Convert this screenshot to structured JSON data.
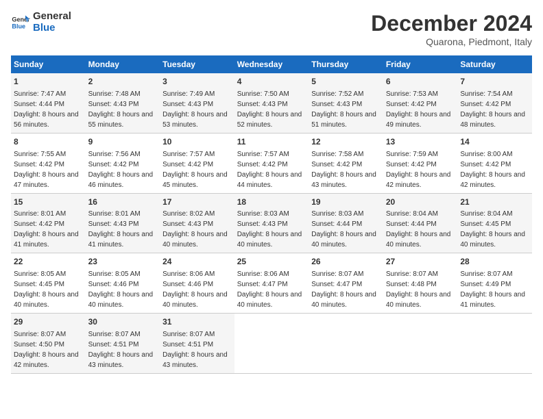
{
  "header": {
    "logo_line1": "General",
    "logo_line2": "Blue",
    "month": "December 2024",
    "location": "Quarona, Piedmont, Italy"
  },
  "days_of_week": [
    "Sunday",
    "Monday",
    "Tuesday",
    "Wednesday",
    "Thursday",
    "Friday",
    "Saturday"
  ],
  "weeks": [
    [
      {
        "day": "1",
        "sunrise": "7:47 AM",
        "sunset": "4:44 PM",
        "daylight": "8 hours and 56 minutes."
      },
      {
        "day": "2",
        "sunrise": "7:48 AM",
        "sunset": "4:43 PM",
        "daylight": "8 hours and 55 minutes."
      },
      {
        "day": "3",
        "sunrise": "7:49 AM",
        "sunset": "4:43 PM",
        "daylight": "8 hours and 53 minutes."
      },
      {
        "day": "4",
        "sunrise": "7:50 AM",
        "sunset": "4:43 PM",
        "daylight": "8 hours and 52 minutes."
      },
      {
        "day": "5",
        "sunrise": "7:52 AM",
        "sunset": "4:43 PM",
        "daylight": "8 hours and 51 minutes."
      },
      {
        "day": "6",
        "sunrise": "7:53 AM",
        "sunset": "4:42 PM",
        "daylight": "8 hours and 49 minutes."
      },
      {
        "day": "7",
        "sunrise": "7:54 AM",
        "sunset": "4:42 PM",
        "daylight": "8 hours and 48 minutes."
      }
    ],
    [
      {
        "day": "8",
        "sunrise": "7:55 AM",
        "sunset": "4:42 PM",
        "daylight": "8 hours and 47 minutes."
      },
      {
        "day": "9",
        "sunrise": "7:56 AM",
        "sunset": "4:42 PM",
        "daylight": "8 hours and 46 minutes."
      },
      {
        "day": "10",
        "sunrise": "7:57 AM",
        "sunset": "4:42 PM",
        "daylight": "8 hours and 45 minutes."
      },
      {
        "day": "11",
        "sunrise": "7:57 AM",
        "sunset": "4:42 PM",
        "daylight": "8 hours and 44 minutes."
      },
      {
        "day": "12",
        "sunrise": "7:58 AM",
        "sunset": "4:42 PM",
        "daylight": "8 hours and 43 minutes."
      },
      {
        "day": "13",
        "sunrise": "7:59 AM",
        "sunset": "4:42 PM",
        "daylight": "8 hours and 42 minutes."
      },
      {
        "day": "14",
        "sunrise": "8:00 AM",
        "sunset": "4:42 PM",
        "daylight": "8 hours and 42 minutes."
      }
    ],
    [
      {
        "day": "15",
        "sunrise": "8:01 AM",
        "sunset": "4:42 PM",
        "daylight": "8 hours and 41 minutes."
      },
      {
        "day": "16",
        "sunrise": "8:01 AM",
        "sunset": "4:43 PM",
        "daylight": "8 hours and 41 minutes."
      },
      {
        "day": "17",
        "sunrise": "8:02 AM",
        "sunset": "4:43 PM",
        "daylight": "8 hours and 40 minutes."
      },
      {
        "day": "18",
        "sunrise": "8:03 AM",
        "sunset": "4:43 PM",
        "daylight": "8 hours and 40 minutes."
      },
      {
        "day": "19",
        "sunrise": "8:03 AM",
        "sunset": "4:44 PM",
        "daylight": "8 hours and 40 minutes."
      },
      {
        "day": "20",
        "sunrise": "8:04 AM",
        "sunset": "4:44 PM",
        "daylight": "8 hours and 40 minutes."
      },
      {
        "day": "21",
        "sunrise": "8:04 AM",
        "sunset": "4:45 PM",
        "daylight": "8 hours and 40 minutes."
      }
    ],
    [
      {
        "day": "22",
        "sunrise": "8:05 AM",
        "sunset": "4:45 PM",
        "daylight": "8 hours and 40 minutes."
      },
      {
        "day": "23",
        "sunrise": "8:05 AM",
        "sunset": "4:46 PM",
        "daylight": "8 hours and 40 minutes."
      },
      {
        "day": "24",
        "sunrise": "8:06 AM",
        "sunset": "4:46 PM",
        "daylight": "8 hours and 40 minutes."
      },
      {
        "day": "25",
        "sunrise": "8:06 AM",
        "sunset": "4:47 PM",
        "daylight": "8 hours and 40 minutes."
      },
      {
        "day": "26",
        "sunrise": "8:07 AM",
        "sunset": "4:47 PM",
        "daylight": "8 hours and 40 minutes."
      },
      {
        "day": "27",
        "sunrise": "8:07 AM",
        "sunset": "4:48 PM",
        "daylight": "8 hours and 40 minutes."
      },
      {
        "day": "28",
        "sunrise": "8:07 AM",
        "sunset": "4:49 PM",
        "daylight": "8 hours and 41 minutes."
      }
    ],
    [
      {
        "day": "29",
        "sunrise": "8:07 AM",
        "sunset": "4:50 PM",
        "daylight": "8 hours and 42 minutes."
      },
      {
        "day": "30",
        "sunrise": "8:07 AM",
        "sunset": "4:51 PM",
        "daylight": "8 hours and 43 minutes."
      },
      {
        "day": "31",
        "sunrise": "8:07 AM",
        "sunset": "4:51 PM",
        "daylight": "8 hours and 43 minutes."
      },
      null,
      null,
      null,
      null
    ]
  ],
  "labels": {
    "sunrise": "Sunrise:",
    "sunset": "Sunset:",
    "daylight": "Daylight:"
  }
}
